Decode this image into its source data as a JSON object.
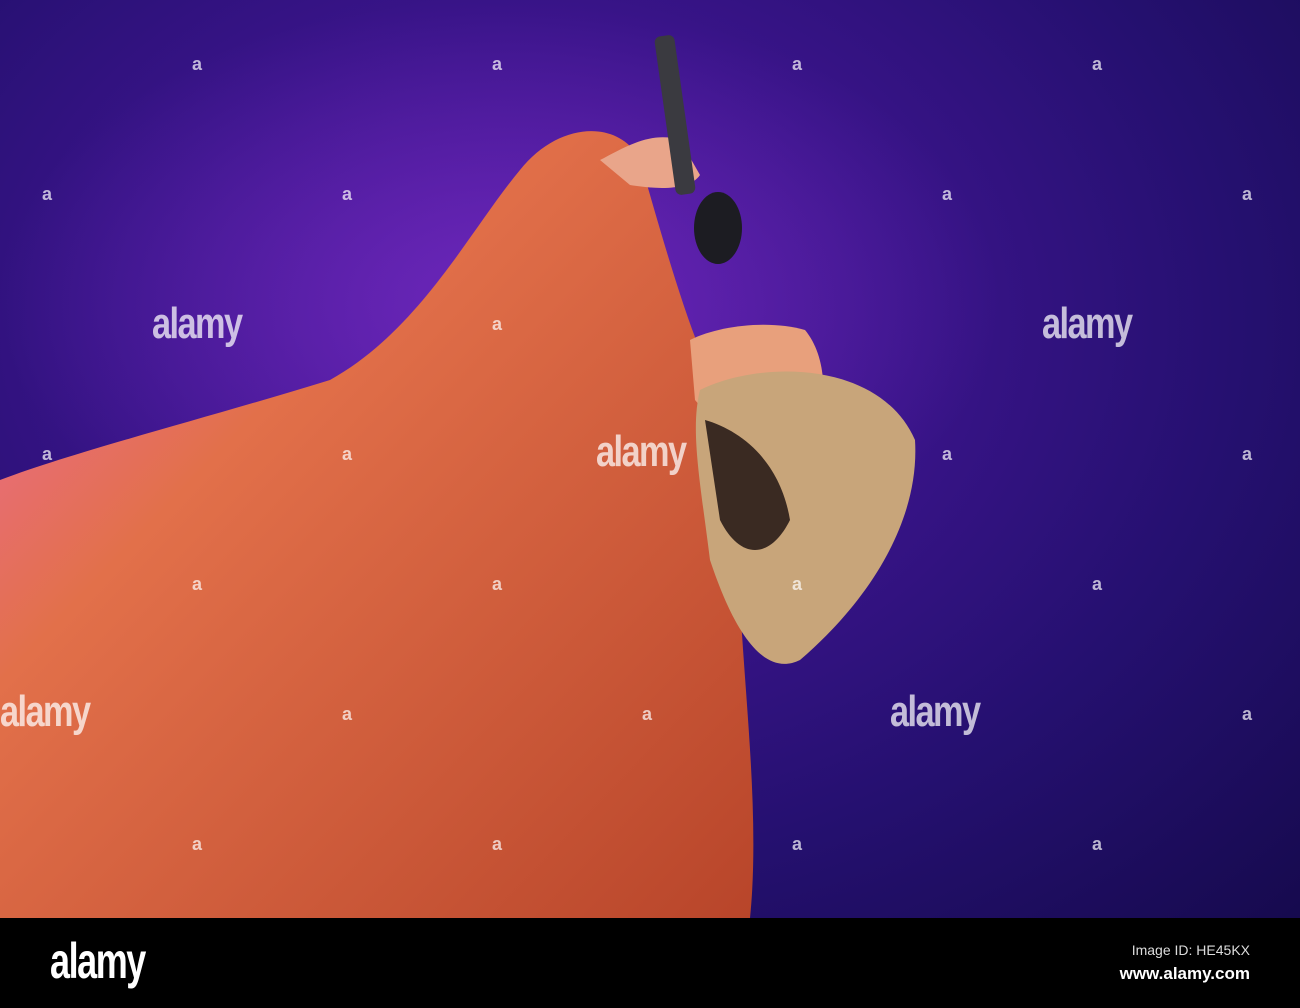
{
  "photo": {
    "subject": "Singer in orange fur coat singing into microphone on purple-lit stage",
    "watermark_text": "alamy",
    "watermark_mark": "a"
  },
  "footer": {
    "logo": "alamy",
    "image_id": "Image ID: HE45KX",
    "url": "www.alamy.com"
  },
  "colors": {
    "background": "#2a1078",
    "coat": "#d8613a",
    "footer": "#000000"
  }
}
